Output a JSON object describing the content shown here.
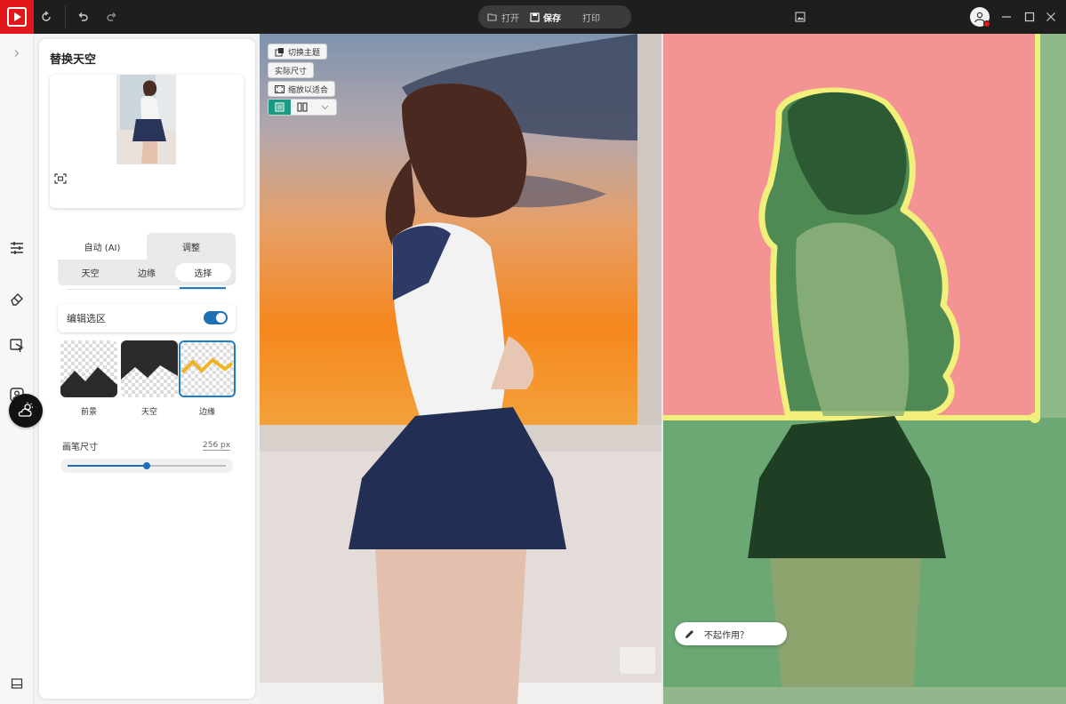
{
  "titlebar": {
    "open_label": "打开",
    "save_label": "保存",
    "print_label": "打印"
  },
  "rail": {
    "icons": [
      "sliders-icon",
      "eraser-icon",
      "cursor-select-icon",
      "portrait-icon",
      "sky-weather-icon",
      "panel-toggle-icon"
    ],
    "active_icon": "sky-weather-icon"
  },
  "panel": {
    "title": "替换天空",
    "mode_tabs": [
      {
        "label": "自动 (AI)",
        "active": false
      },
      {
        "label": "调整",
        "active": true
      }
    ],
    "sub_tabs": [
      {
        "label": "天空",
        "active": false
      },
      {
        "label": "边缘",
        "active": false
      },
      {
        "label": "选择",
        "active": true
      }
    ],
    "edit_selection_label": "编辑选区",
    "edit_selection_enabled": true,
    "tiles": [
      {
        "label": "前景",
        "selected": false
      },
      {
        "label": "天空",
        "selected": false
      },
      {
        "label": "边缘",
        "selected": true
      }
    ],
    "brush_size_label": "画笔尺寸",
    "brush_size_value": "256 px",
    "brush_size_fraction": 0.5
  },
  "canvas": {
    "switch_subject_label": "切换主题",
    "actual_size_label": "实际尺寸",
    "fit_label": "缩放以适合",
    "help_label": "不起作用？"
  },
  "colors": {
    "brand_red": "#e3161b",
    "accent_blue": "#1f6fb5",
    "teal": "#1a9a82",
    "mask_sky": "#f49393",
    "mask_fg": "#6ba874",
    "mask_edge": "#f2f07a"
  }
}
